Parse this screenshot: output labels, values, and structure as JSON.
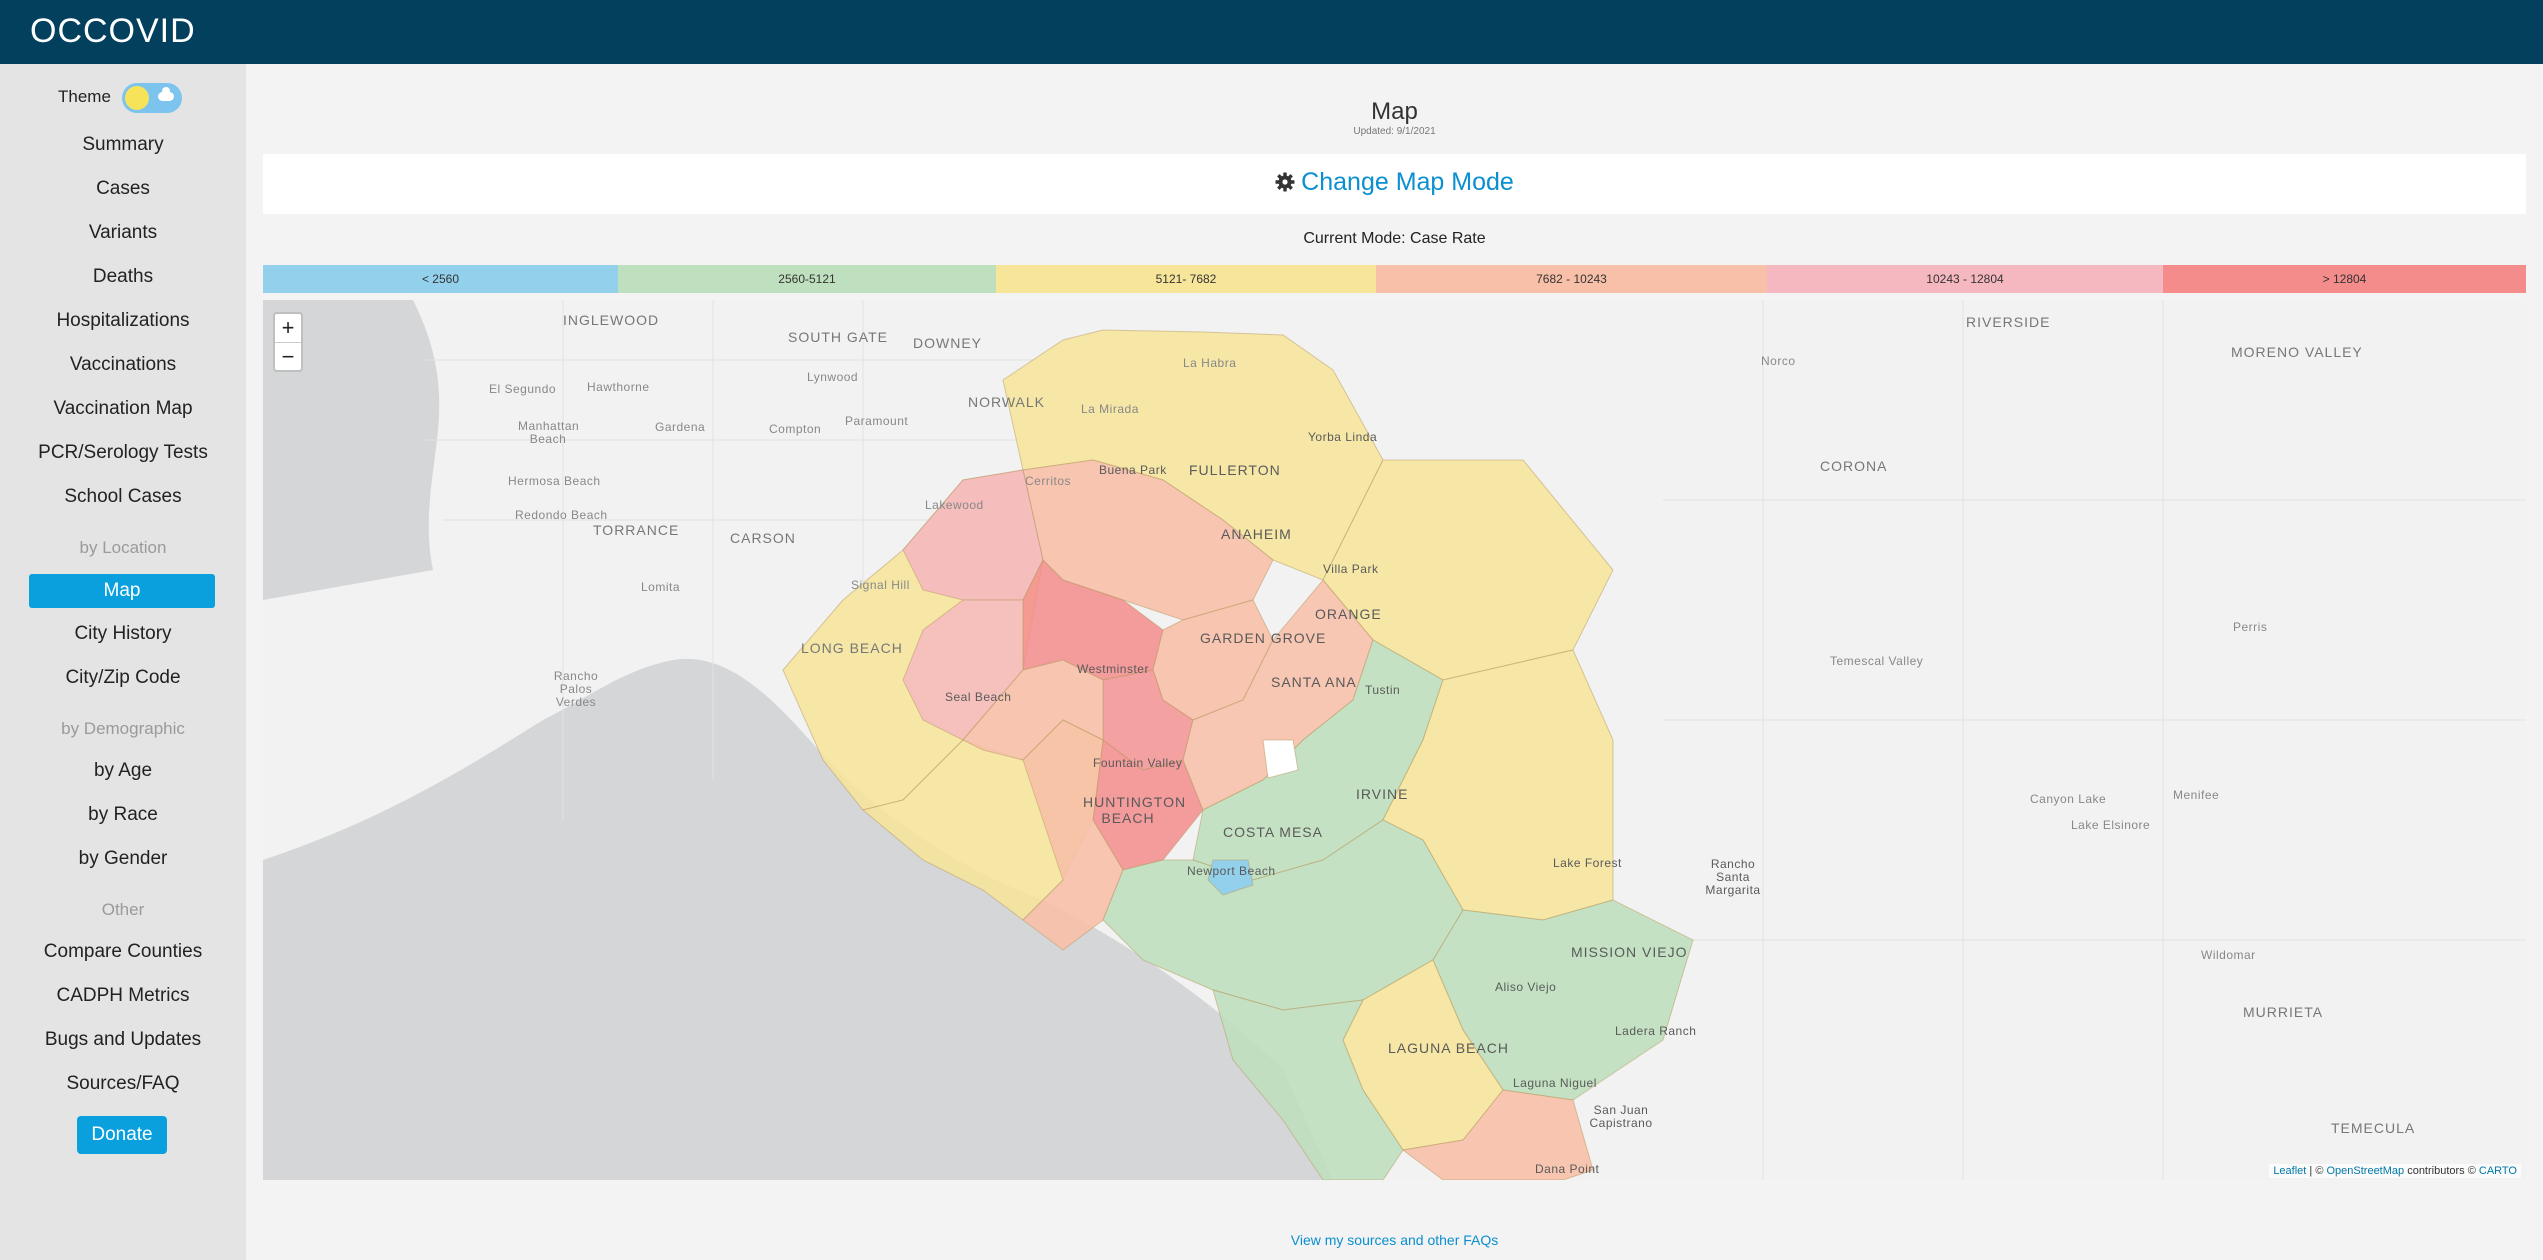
{
  "app": {
    "brand": "OCCOVID"
  },
  "sidebar": {
    "theme_label": "Theme",
    "items_main": [
      "Summary",
      "Cases",
      "Variants",
      "Deaths",
      "Hospitalizations",
      "Vaccinations",
      "Vaccination Map",
      "PCR/Serology Tests",
      "School Cases"
    ],
    "section_location": "by Location",
    "active_item": "Map",
    "items_location": [
      "City History",
      "City/Zip Code"
    ],
    "section_demographic": "by Demographic",
    "items_demographic": [
      "by Age",
      "by Race",
      "by Gender"
    ],
    "section_other": "Other",
    "items_other": [
      "Compare Counties",
      "CADPH Metrics",
      "Bugs and Updates",
      "Sources/FAQ"
    ],
    "donate_label": "Donate"
  },
  "main": {
    "title": "Map",
    "updated": "Updated: 9/1/2021",
    "change_mode_label": "Change Map Mode",
    "current_mode": "Current Mode: Case Rate",
    "legend": [
      {
        "label": "< 2560",
        "color": "#93d0ec"
      },
      {
        "label": "2560-5121",
        "color": "#bfe0be"
      },
      {
        "label": "5121- 7682",
        "color": "#f7e59a"
      },
      {
        "label": "7682 - 10243",
        "color": "#f8c0a8"
      },
      {
        "label": "10243 - 12804",
        "color": "#f6b8c0"
      },
      {
        "label": "> 12804",
        "color": "#f48c8c"
      }
    ],
    "map": {
      "zoom_in": "+",
      "zoom_out": "−",
      "attribution_leaflet": "Leaflet",
      "attribution_sep": " | © ",
      "attribution_osm": "OpenStreetMap",
      "attribution_mid": " contributors © ",
      "attribution_carto": "CARTO",
      "labels": {
        "inglewood": "INGLEWOOD",
        "south_gate": "SOUTH GATE",
        "downey": "DOWNEY",
        "el_segundo": "El Segundo",
        "hawthorne": "Hawthorne",
        "lynwood": "Lynwood",
        "norwalk": "NORWALK",
        "la_mirada": "La Mirada",
        "la_habra": "La Habra",
        "manhattan_beach": "Manhattan Beach",
        "gardena": "Gardena",
        "compton": "Compton",
        "paramount": "Paramount",
        "buena_park": "Buena Park",
        "fullerton": "FULLERTON",
        "yorba_linda": "Yorba Linda",
        "hermosa_beach": "Hermosa Beach",
        "cerritos": "Cerritos",
        "redondo_beach": "Redondo Beach",
        "torrance": "TORRANCE",
        "carson": "CARSON",
        "lakewood": "Lakewood",
        "anaheim": "ANAHEIM",
        "lomita": "Lomita",
        "signal_hill": "Signal Hill",
        "orange": "ORANGE",
        "villa_park": "Villa Park",
        "long_beach": "LONG BEACH",
        "garden_grove": "GARDEN GROVE",
        "rancho_palos_verdes": "Rancho Palos Verdes",
        "westminster": "Westminster",
        "seal_beach": "Seal Beach",
        "santa_ana": "SANTA ANA",
        "tustin": "Tustin",
        "fountain_valley": "Fountain Valley",
        "huntington_beach": "HUNTINGTON BEACH",
        "irvine": "IRVINE",
        "costa_mesa": "COSTA MESA",
        "newport_beach": "Newport Beach",
        "lake_forest": "Lake Forest",
        "rancho_santa_margarita": "Rancho Santa Margarita",
        "mission_viejo": "MISSION VIEJO",
        "aliso_viejo": "Aliso Viejo",
        "ladera_ranch": "Ladera Ranch",
        "laguna_beach": "LAGUNA BEACH",
        "laguna_niguel": "Laguna Niguel",
        "san_juan_capistrano": "San Juan Capistrano",
        "dana_point": "Dana Point",
        "riverside": "RIVERSIDE",
        "norco": "Norco",
        "moreno_valley": "MORENO VALLEY",
        "corona": "CORONA",
        "perris": "Perris",
        "temescal_valley": "Temescal Valley",
        "canyon_lake": "Canyon Lake",
        "menifee": "Menifee",
        "lake_elsinore": "Lake Elsinore",
        "wildomar": "Wildomar",
        "murrieta": "MURRIETA",
        "temecula": "TEMECULA"
      }
    },
    "footer_link": "View my sources and other FAQs"
  }
}
